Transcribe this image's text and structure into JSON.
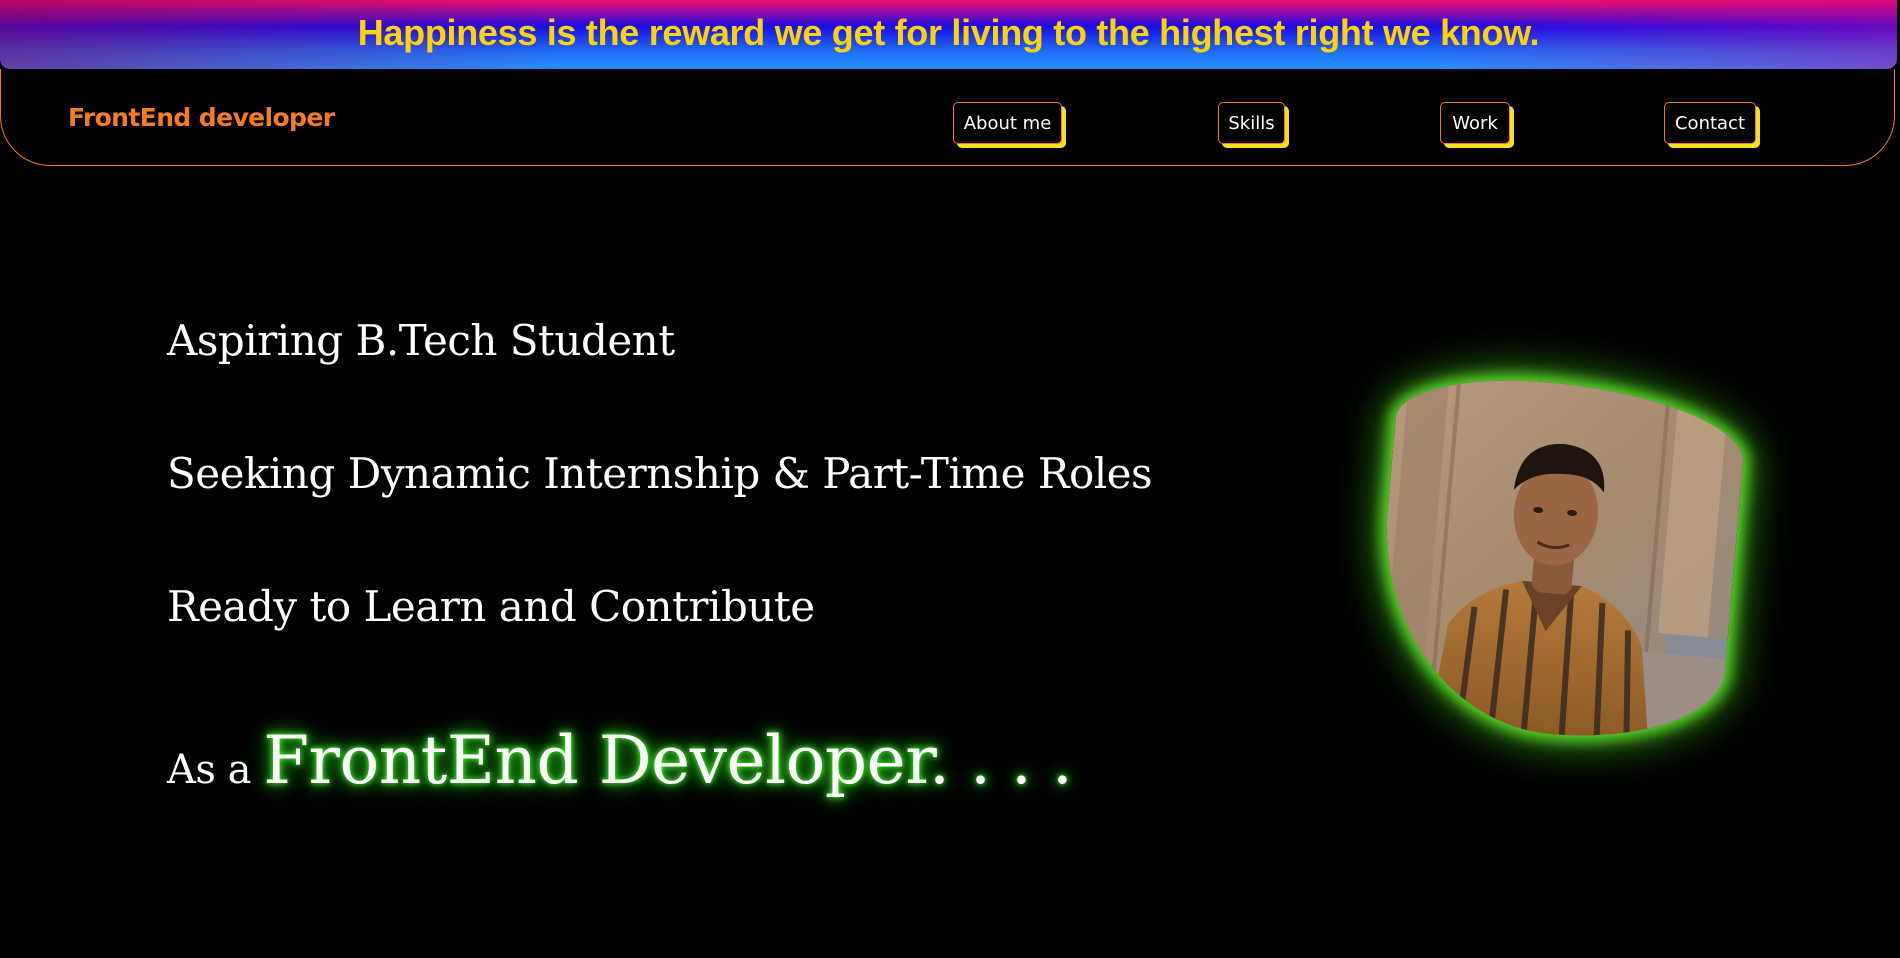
{
  "banner": {
    "quote": "Happiness is the reward we get for living to the highest right we know."
  },
  "navbar": {
    "brand": "FrontEnd developer",
    "links": [
      {
        "label": "About me"
      },
      {
        "label": "Skills"
      },
      {
        "label": "Work"
      },
      {
        "label": "Contact"
      }
    ]
  },
  "hero": {
    "line1": "Aspiring B.Tech Student",
    "line2": "Seeking Dynamic Internship & Part-Time Roles",
    "line3": "Ready to Learn and Contribute",
    "prefix": "As a",
    "highlight": "FrontEnd Developer. . . ."
  },
  "colors": {
    "background": "#000000",
    "brand": "#f37d22",
    "banner_text": "#ffd400",
    "button_shadow": "#f4e01e",
    "glow": "#4cff3a"
  }
}
